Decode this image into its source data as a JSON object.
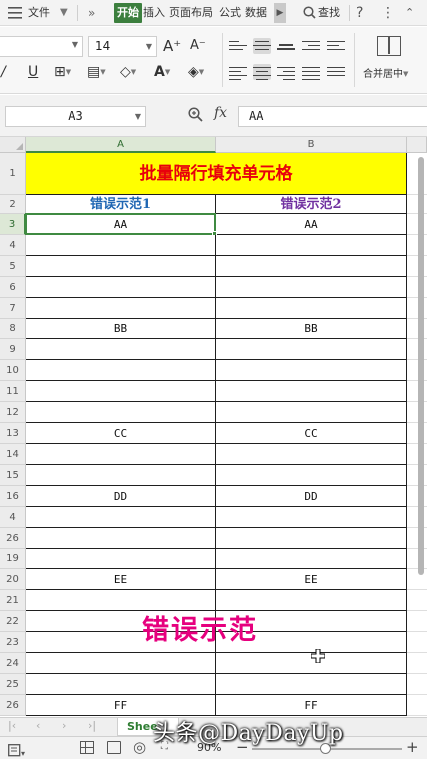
{
  "menubar": {
    "file": "文件",
    "more": "»",
    "tabs": [
      "开始",
      "插入",
      "页面布局",
      "公式",
      "数据"
    ],
    "search": "查找",
    "help": "?",
    "overflow": "⋮",
    "collapse": "⌃"
  },
  "ribbon": {
    "font_size": "14",
    "grow_font": "A⁺",
    "shrink_font": "A⁻",
    "underline": "U",
    "merge_label": "合并居中"
  },
  "formula_bar": {
    "name_box": "A3",
    "fx": "fx",
    "value": "AA"
  },
  "sheet": {
    "columns": [
      "A",
      "B"
    ],
    "title": "批量隔行填充单元格",
    "header_a": "错误示范1",
    "header_b": "错误示范2",
    "header_a_color": "#1f66b3",
    "header_b_color": "#7030a0",
    "title_bg": "#ffff00",
    "title_color": "#e8000c",
    "rows": [
      {
        "num": "3",
        "a": "AA",
        "b": "AA",
        "selected": true
      },
      {
        "num": "4",
        "a": "",
        "b": ""
      },
      {
        "num": "5",
        "a": "",
        "b": ""
      },
      {
        "num": "6",
        "a": "",
        "b": ""
      },
      {
        "num": "7",
        "a": "",
        "b": ""
      },
      {
        "num": "8",
        "a": "BB",
        "b": "BB"
      },
      {
        "num": "9",
        "a": "",
        "b": ""
      },
      {
        "num": "10",
        "a": "",
        "b": ""
      },
      {
        "num": "11",
        "a": "",
        "b": ""
      },
      {
        "num": "12",
        "a": "",
        "b": ""
      },
      {
        "num": "13",
        "a": "CC",
        "b": "CC"
      },
      {
        "num": "14",
        "a": "",
        "b": ""
      },
      {
        "num": "15",
        "a": "",
        "b": ""
      },
      {
        "num": "16",
        "a": "DD",
        "b": "DD"
      },
      {
        "num": "4",
        "a": "",
        "b": ""
      },
      {
        "num": "26",
        "a": "",
        "b": ""
      },
      {
        "num": "19",
        "a": "",
        "b": ""
      },
      {
        "num": "20",
        "a": "EE",
        "b": "EE"
      },
      {
        "num": "21",
        "a": "",
        "b": ""
      },
      {
        "num": "22",
        "a": "",
        "b": ""
      },
      {
        "num": "23",
        "a": "",
        "b": ""
      },
      {
        "num": "24",
        "a": "",
        "b": ""
      },
      {
        "num": "25",
        "a": "",
        "b": ""
      },
      {
        "num": "26",
        "a": "FF",
        "b": "FF"
      }
    ],
    "header_rows": [
      "1",
      "2"
    ]
  },
  "overlay": {
    "label": "错误示范"
  },
  "tabs": {
    "sheet_name": "Shee"
  },
  "status": {
    "zoom": "90%",
    "zoom_level": 0.45,
    "minus": "−",
    "plus": "+"
  },
  "watermark": "头条@DayDayUp"
}
